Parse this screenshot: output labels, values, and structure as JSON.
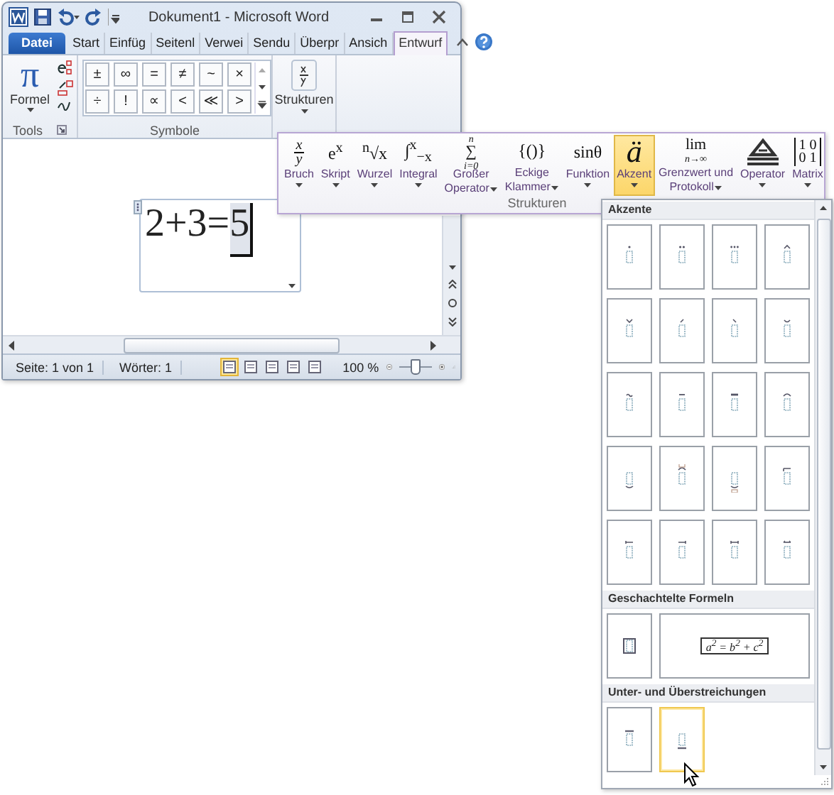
{
  "window": {
    "title": "Dokument1 - Microsoft Word"
  },
  "tabs": [
    {
      "label": "Datei",
      "kind": "file",
      "selected": false
    },
    {
      "label": "Start",
      "kind": "tab",
      "selected": false
    },
    {
      "label": "Einfüg",
      "kind": "tab",
      "selected": false
    },
    {
      "label": "Seitenl",
      "kind": "tab",
      "selected": false
    },
    {
      "label": "Verwei",
      "kind": "tab",
      "selected": false
    },
    {
      "label": "Sendu",
      "kind": "tab",
      "selected": false
    },
    {
      "label": "Überpr",
      "kind": "tab",
      "selected": false
    },
    {
      "label": "Ansich",
      "kind": "tab",
      "selected": false
    },
    {
      "label": "Entwurf",
      "kind": "tab",
      "selected": true
    }
  ],
  "ribbon": {
    "tools": {
      "symbol": "π",
      "button": "Formel",
      "label": "Tools"
    },
    "symbols": {
      "label": "Symbole",
      "items": [
        "±",
        "∞",
        "=",
        "≠",
        "~",
        "×",
        "÷",
        "!",
        "∝",
        "<",
        "≪",
        ">"
      ]
    },
    "structures": {
      "button": "Strukturen"
    }
  },
  "document": {
    "equation": {
      "text": "2+3=",
      "selected_text": "5"
    }
  },
  "status_bar": {
    "page": "Seite: 1 von 1",
    "words": "Wörter: 1",
    "views": [
      {
        "selected": true
      },
      {
        "selected": false
      },
      {
        "selected": false
      },
      {
        "selected": false
      },
      {
        "selected": false
      }
    ],
    "zoom": "100 %",
    "zoom_slider": {
      "level": 0.5
    }
  },
  "structures_panel": {
    "label": "Strukturen",
    "items": [
      {
        "kind": "fraction",
        "top": "x",
        "bottom": "y",
        "label": [
          "Bruch"
        ],
        "selected": false
      },
      {
        "kind": "glyph",
        "glyph": "e$^{x}$",
        "label": [
          "Skript"
        ],
        "selected": false
      },
      {
        "kind": "glyph",
        "glyph": "$^{n}$√x",
        "label": [
          "Wurzel"
        ],
        "selected": false
      },
      {
        "kind": "glyph",
        "glyph": "∫$^{x}$$_{−x}$",
        "label": [
          "Integral"
        ],
        "selected": false
      },
      {
        "kind": "stack",
        "above": "n",
        "main": "∑",
        "below": "i=0",
        "label": [
          "Großer",
          "Operator"
        ],
        "selected": false
      },
      {
        "kind": "glyph",
        "glyph": "{()}",
        "label": [
          "Eckige",
          "Klammer"
        ],
        "selected": false
      },
      {
        "kind": "glyph",
        "glyph": "sinθ",
        "label": [
          "Funktion"
        ],
        "selected": false
      },
      {
        "kind": "glyph",
        "glyph": "ä",
        "label": [
          "Akzent"
        ],
        "selected": true
      },
      {
        "kind": "stack",
        "main": "lim",
        "below": "n→∞",
        "label": [
          "Grenzwert und",
          "Protokoll"
        ],
        "selected": false
      },
      {
        "kind": "icon",
        "label": [
          "Operator"
        ],
        "selected": false
      },
      {
        "kind": "matrix",
        "rows": [
          "1 0",
          "0 1"
        ],
        "label": [
          "Matrix"
        ],
        "selected": false
      }
    ]
  },
  "gallery": {
    "sections": [
      {
        "title": "Akzente",
        "items": [
          {
            "kind": "template",
            "selected": false
          },
          {
            "kind": "template",
            "selected": false
          },
          {
            "kind": "template",
            "selected": false
          },
          {
            "kind": "template",
            "selected": false
          },
          {
            "kind": "template",
            "selected": false
          },
          {
            "kind": "template",
            "selected": false
          },
          {
            "kind": "template",
            "selected": false
          },
          {
            "kind": "template",
            "selected": false
          },
          {
            "kind": "template",
            "selected": false
          },
          {
            "kind": "template",
            "selected": false
          },
          {
            "kind": "template",
            "selected": false
          },
          {
            "kind": "template",
            "selected": false
          },
          {
            "kind": "template",
            "selected": false
          },
          {
            "kind": "template",
            "selected": false
          },
          {
            "kind": "template",
            "selected": false
          },
          {
            "kind": "template",
            "selected": false
          },
          {
            "kind": "template",
            "selected": false
          },
          {
            "kind": "template",
            "selected": false
          },
          {
            "kind": "template",
            "selected": false
          },
          {
            "kind": "template",
            "selected": false
          }
        ]
      },
      {
        "title": "Geschachtelte Formeln",
        "items": [
          {
            "kind": "template",
            "selected": false
          },
          {
            "kind": "formula",
            "formula": "a$^{2}$ = b$^{2}$ + c$^{2}$",
            "selected": false
          }
        ]
      },
      {
        "title": "Unter- und Überstreichungen",
        "items": [
          {
            "kind": "template",
            "selected": false
          },
          {
            "kind": "template",
            "selected": true
          }
        ]
      }
    ]
  }
}
